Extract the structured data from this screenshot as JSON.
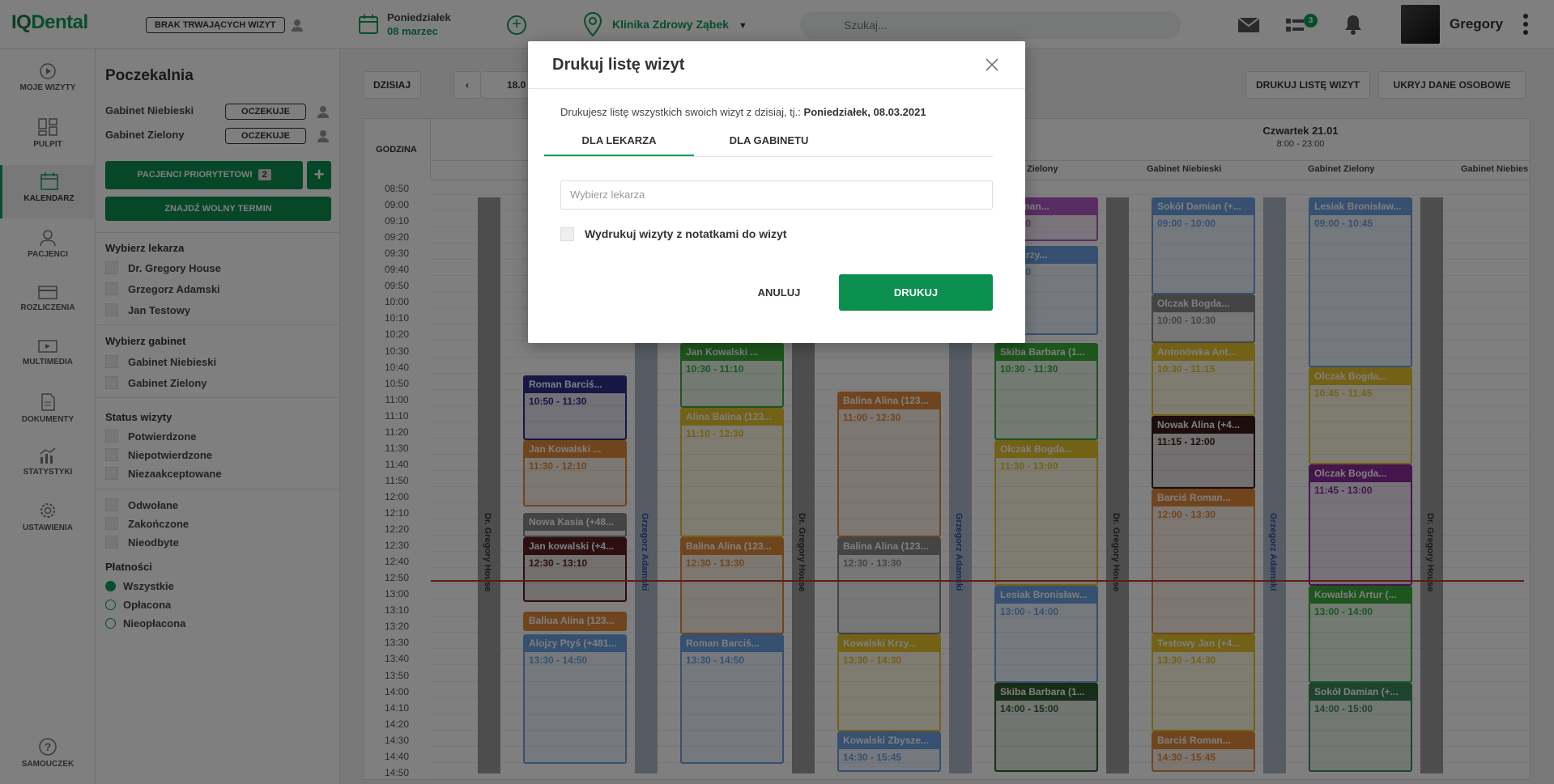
{
  "header": {
    "logo_a": "IQ",
    "logo_b": "Dental",
    "no_visits_label": "BRAK TRWAJĄCYCH WIZYT",
    "date_day": "Poniedziałek",
    "date_date": "08 marzec",
    "clinic": "Klinika Zdrowy Ząbek",
    "search_placeholder": "Szukaj...",
    "messages_badge": "3",
    "username": "Gregory"
  },
  "nav": {
    "items": [
      {
        "label": "MOJE WIZYTY"
      },
      {
        "label": "PULPIT"
      },
      {
        "label": "KALENDARZ"
      },
      {
        "label": "PACJENCI"
      },
      {
        "label": "ROZLICZENIA"
      },
      {
        "label": "MULTIMEDIA"
      },
      {
        "label": "DOKUMENTY"
      },
      {
        "label": "STATYSTYKI"
      },
      {
        "label": "USTAWIENIA"
      }
    ],
    "help": "SAMOUCZEK"
  },
  "waiting_room": {
    "title": "Poczekalnia",
    "rooms": [
      {
        "name": "Gabinet Niebieski",
        "status": "OCZEKUJE"
      },
      {
        "name": "Gabinet Zielony",
        "status": "OCZEKUJE"
      }
    ],
    "priority_btn": "PACJENCI PRIORYTETOWI",
    "priority_count": "2",
    "find_btn": "ZNAJDŹ WOLNY TERMIN",
    "doctor_title": "Wybierz lekarza",
    "doctors": [
      "Dr. Gregory House",
      "Grzegorz Adamski",
      "Jan Testowy"
    ],
    "office_title": "Wybierz gabinet",
    "offices": [
      "Gabinet Niebieski",
      "Gabinet Zielony"
    ],
    "status_title": "Status wizyty",
    "statuses": [
      "Potwierdzone",
      "Niepotwierdzone",
      "Niezaakceptowane"
    ],
    "statuses2": [
      "Odwołane",
      "Zakończone",
      "Nieodbyte"
    ],
    "payment_title": "Płatności",
    "payments": [
      "Wszystkie",
      "Opłacona",
      "Nieopłacona"
    ]
  },
  "calendar": {
    "today_btn": "DZISIAJ",
    "range": "18.0",
    "print_btn": "DRUKUJ LISTĘ WIZYT",
    "hide_btn": "UKRYJ DANE OSOBOWE",
    "hour_header": "GODZINA",
    "day_head": "Czwartek 21.01",
    "day_hours": "8:00 - 23:00",
    "col_heads": [
      "Zielony",
      "Gabinet Niebieski",
      "Gabinet Zielony",
      "Gabinet Niebies"
    ],
    "hours": [
      "08:50",
      "09:00",
      "09:10",
      "09:20",
      "09:30",
      "09:40",
      "09:50",
      "10:00",
      "10:10",
      "10:20",
      "10:30",
      "10:40",
      "10:50",
      "11:00",
      "11:10",
      "11:20",
      "11:30",
      "11:40",
      "11:50",
      "12:00",
      "12:10",
      "12:20",
      "12:30",
      "12:40",
      "12:50",
      "13:00",
      "13:10",
      "13:20",
      "13:30",
      "13:40",
      "13:50",
      "14:00",
      "14:10",
      "14:20",
      "14:30",
      "14:40",
      "14:50"
    ],
    "doctors_strips": [
      "Dr. Gregory House",
      "Grzegorz Adamski",
      "Dr. Gregory House",
      "Grzegorz Adamski",
      "Dr. Gregory House",
      "Grzegorz Adamski",
      "Dr. Gregory House"
    ],
    "appointments": [
      {
        "title": "Roman Barciś...",
        "time": "10:50 - 11:30",
        "color": "#2c2f8a"
      },
      {
        "title": "Jan Kowalski ...",
        "time": "11:30 - 12:10",
        "color": "#e08a3c"
      },
      {
        "title": "Nowa Kasia (+48...",
        "time": "",
        "color": "#888888"
      },
      {
        "title": "Jan kowalski (+4...",
        "time": "12:30 - 13:10",
        "color": "#5a1f1f"
      },
      {
        "title": "Baliua Alina (123...",
        "time": "",
        "color": "#e08a3c"
      },
      {
        "title": "Alojzy Ptyś (+481...",
        "time": "13:30 - 14:50",
        "color": "#6aa0e0"
      },
      {
        "title": "Jan Kowalski ...",
        "time": "10:30 - 11:10",
        "color": "#3aaa3a"
      },
      {
        "title": "Alina Balina (123...",
        "time": "11:10 - 12:30",
        "color": "#e6c22a"
      },
      {
        "title": "Balina Alina (123...",
        "time": "12:30 - 13:30",
        "color": "#e08a3c"
      },
      {
        "title": "Roman Barciś...",
        "time": "13:30 - 14:50",
        "color": "#6aa0e0"
      },
      {
        "title": "Balina Alina (123...",
        "time": "11:00 - 12:30",
        "color": "#e08a3c"
      },
      {
        "title": "Balina Alina (123...",
        "time": "12:30 - 13:30",
        "color": "#888888"
      },
      {
        "title": "Kowalski Krzy...",
        "time": "13:30 - 14:30",
        "color": "#e6c22a"
      },
      {
        "title": "Kowalski Zbysze...",
        "time": "14:30 - 15:45",
        "color": "#6aa0e0"
      },
      {
        "title": "ś Roman...",
        "time": "- 09:30",
        "color": "#b25bc6"
      },
      {
        "title": "lski Krzy...",
        "time": "- 10:30",
        "color": "#6aa0e0"
      },
      {
        "title": "Skiba Barbara (1...",
        "time": "10:30 - 11:30",
        "color": "#3aaa3a"
      },
      {
        "title": "Olczak Bogda...",
        "time": "11:30 - 13:00",
        "color": "#e6c22a"
      },
      {
        "title": "Lesiak Bronisław...",
        "time": "13:00 - 14:00",
        "color": "#6aa0e0"
      },
      {
        "title": "Skiba Barbara (1...",
        "time": "14:00 - 15:00",
        "color": "#2e5a2e"
      },
      {
        "title": "Sokół Damian (+...",
        "time": "09:00 - 10:00",
        "color": "#6aa0e0"
      },
      {
        "title": "Olczak Bogda...",
        "time": "10:00 - 10:30",
        "color": "#888888"
      },
      {
        "title": "Antonówka Ant...",
        "time": "10:30 - 11:15",
        "color": "#e6c22a"
      },
      {
        "title": "Nowak Alina (+4...",
        "time": "11:15 - 12:00",
        "color": "#3a1a1a"
      },
      {
        "title": "Barciś Roman...",
        "time": "12:00 - 13:30",
        "color": "#e08a3c"
      },
      {
        "title": "Testowy Jan (+4...",
        "time": "13:30 - 14:30",
        "color": "#e6c22a"
      },
      {
        "title": "Barciś Roman...",
        "time": "14:30 - 15:45",
        "color": "#e08a3c"
      },
      {
        "title": "Lesiak Bronisław...",
        "time": "09:00 - 10:45",
        "color": "#6aa0e0"
      },
      {
        "title": "Olczak Bogda...",
        "time": "10:45 - 11:45",
        "color": "#e6c22a"
      },
      {
        "title": "Olczak Bogda...",
        "time": "11:45 - 13:00",
        "color": "#8a2a9a"
      },
      {
        "title": "Kowalski Artur (...",
        "time": "13:00 - 14:00",
        "color": "#3aaa3a"
      },
      {
        "title": "Sokół Damian (+...",
        "time": "14:00 - 15:00",
        "color": "#3a8a5a"
      }
    ]
  },
  "modal": {
    "title": "Drukuj listę wizyt",
    "info_prefix": "Drukujesz listę wszystkich swoich wizyt z dzisiaj, tj.:",
    "info_date": "Poniedziałek, 08.03.2021",
    "tabs": [
      "DLA LEKARZA",
      "DLA GABINETU"
    ],
    "doctor_placeholder": "Wybierz lekarza",
    "notes_label": "Wydrukuj wizyty z notatkami do wizyt",
    "cancel": "ANULUJ",
    "print": "DRUKUJ"
  }
}
